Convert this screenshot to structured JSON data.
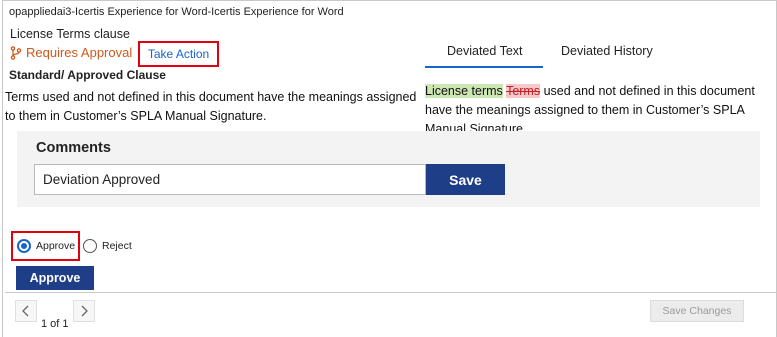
{
  "app": {
    "title": "opappliedai3-Icertis Experience for Word-Icertis Experience for Word"
  },
  "clause": {
    "title": "License Terms clause",
    "status_label": "Requires Approval",
    "status_icon": "branch-icon",
    "take_action_label": "Take Action"
  },
  "tabs": [
    {
      "label": "Deviated Text",
      "active": true
    },
    {
      "label": "Deviated History",
      "active": false
    }
  ],
  "standard": {
    "label": "Standard/ Approved Clause",
    "text": "Terms used and not defined in this document have the meanings assigned to them in Customer’s SPLA Manual Signature."
  },
  "deviated": {
    "added": "License terms",
    "space": " ",
    "removed": "Terms",
    "rest": " used and not defined in this document have the meanings assigned to them in Customer’s SPLA Manual Signature."
  },
  "comments": {
    "label": "Comments",
    "value": "Deviation Approved",
    "save_label": "Save"
  },
  "decision": {
    "options": [
      {
        "label": "Approve",
        "checked": true
      },
      {
        "label": "Reject",
        "checked": false
      }
    ],
    "submit_label": "Approve"
  },
  "footer": {
    "prev_icon": "chevron-left-icon",
    "next_icon": "chevron-right-icon",
    "page_text": "1 of 1",
    "save_changes_label": "Save Changes"
  },
  "colors": {
    "accent_blue": "#1666c8",
    "button_navy": "#1e3f88",
    "status_orange": "#d0581c",
    "highlight_red": "#e0000f",
    "added_green": "#cde7b3",
    "removed_red": "#f6c8c8"
  }
}
